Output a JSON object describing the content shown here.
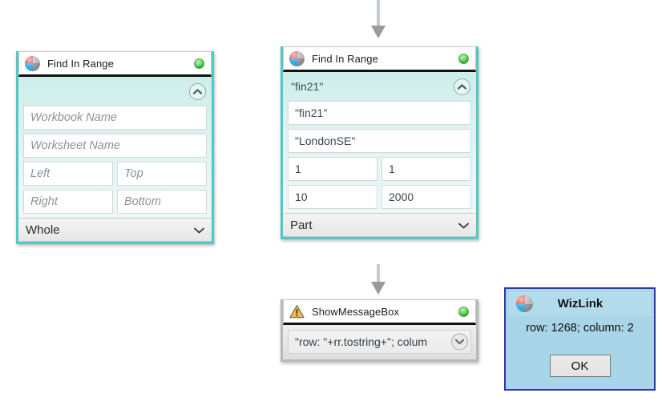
{
  "canvas": {
    "background": "#ffffff",
    "accent_teal": "#4fc9c3",
    "status_green": "#37b534",
    "dialog_border": "#3333aa",
    "dialog_bg": "#a8d5e8",
    "connector_color": "#9a9a9a"
  },
  "nodes": [
    {
      "id": "find-in-range-empty",
      "title": "Find In Range",
      "icon": "wizlink-sphere-icon",
      "status": "ready",
      "header_label": "",
      "collapse_icon": "chevron-up-icon",
      "fields": [
        [
          {
            "value": "",
            "placeholder": "Workbook Name"
          }
        ],
        [
          {
            "value": "",
            "placeholder": "Worksheet Name"
          }
        ],
        [
          {
            "value": "",
            "placeholder": "Left"
          },
          {
            "value": "",
            "placeholder": "Top"
          }
        ],
        [
          {
            "value": "",
            "placeholder": "Right"
          },
          {
            "value": "",
            "placeholder": "Bottom"
          }
        ]
      ],
      "dropdown": {
        "value": "Whole",
        "icon": "chevron-down-icon"
      }
    },
    {
      "id": "find-in-range-filled",
      "title": "Find In Range",
      "icon": "wizlink-sphere-icon",
      "status": "ready",
      "header_label": "\"fin21\"",
      "collapse_icon": "chevron-up-icon",
      "fields": [
        [
          {
            "value": "\"fin21\"",
            "placeholder": "Workbook Name"
          }
        ],
        [
          {
            "value": "\"LondonSE\"",
            "placeholder": "Worksheet Name"
          }
        ],
        [
          {
            "value": "1",
            "placeholder": "Left"
          },
          {
            "value": "1",
            "placeholder": "Top"
          }
        ],
        [
          {
            "value": "10",
            "placeholder": "Right"
          },
          {
            "value": "2000",
            "placeholder": "Bottom"
          }
        ]
      ],
      "dropdown": {
        "value": "Part",
        "icon": "chevron-down-icon"
      }
    },
    {
      "id": "show-message-box",
      "title": "ShowMessageBox",
      "icon": "warning-triangle-icon",
      "status": "ready",
      "message_expression": "\"row: \"+rr.tostring+\"; colum",
      "expand_icon": "chevron-down-circle-icon"
    }
  ],
  "dialog": {
    "title": "WizLink",
    "icon": "wizlink-sphere-icon",
    "message": "row: 1268; column: 2",
    "ok_label": "OK"
  },
  "connectors": [
    {
      "name": "connector-top-to-find-in-range",
      "icon": "arrow-down-icon"
    },
    {
      "name": "connector-find-in-range-to-message-box",
      "icon": "arrow-down-icon"
    }
  ]
}
